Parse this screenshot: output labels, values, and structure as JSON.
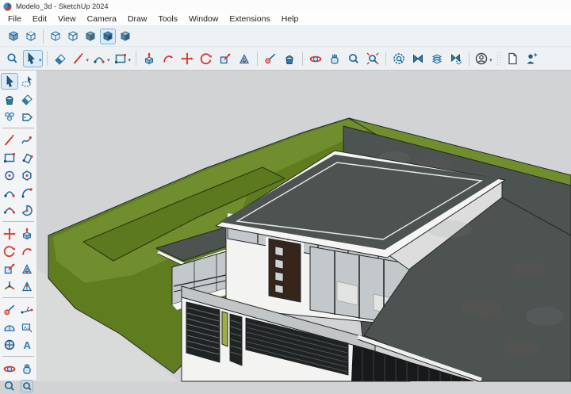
{
  "window": {
    "title": "Modelo_3d - SketchUp 2024"
  },
  "menu": {
    "items": [
      "File",
      "Edit",
      "View",
      "Camera",
      "Draw",
      "Tools",
      "Window",
      "Extensions",
      "Help"
    ]
  },
  "toolbars": {
    "views": {
      "items": [
        {
          "name": "xray",
          "label": "X-Ray"
        },
        {
          "name": "back-edges",
          "label": "Back Edges"
        },
        {
          "type": "sep"
        },
        {
          "name": "wireframe",
          "label": "Wireframe"
        },
        {
          "name": "hidden-line",
          "label": "Hidden Line"
        },
        {
          "name": "shaded",
          "label": "Shaded"
        },
        {
          "name": "shaded-textures",
          "label": "Shaded With Textures",
          "selected": true
        },
        {
          "name": "monochrome",
          "label": "Monochrome"
        }
      ]
    },
    "main": {
      "items": [
        {
          "name": "search",
          "label": "Search"
        },
        {
          "name": "select",
          "label": "Select",
          "selected": true,
          "dropdown": true
        },
        {
          "type": "sep"
        },
        {
          "name": "eraser",
          "label": "Eraser"
        },
        {
          "name": "line",
          "label": "Line",
          "dropdown": true
        },
        {
          "name": "two-point-arc",
          "label": "Arcs",
          "dropdown": true
        },
        {
          "name": "rectangle",
          "label": "Shapes",
          "dropdown": true
        },
        {
          "type": "sep"
        },
        {
          "name": "push-pull",
          "label": "Push/Pull"
        },
        {
          "name": "follow-me",
          "label": "Follow Me"
        },
        {
          "name": "move",
          "label": "Move"
        },
        {
          "name": "rotate",
          "label": "Rotate"
        },
        {
          "name": "scale",
          "label": "Scale"
        },
        {
          "name": "offset",
          "label": "Offset"
        },
        {
          "type": "sep"
        },
        {
          "name": "tape-measure",
          "label": "Tape Measure"
        },
        {
          "name": "paint-bucket",
          "label": "Paint Bucket"
        },
        {
          "type": "sep"
        },
        {
          "name": "orbit",
          "label": "Orbit"
        },
        {
          "name": "pan",
          "label": "Pan"
        },
        {
          "name": "zoom",
          "label": "Zoom"
        },
        {
          "name": "zoom-extents",
          "label": "Zoom Extents"
        },
        {
          "type": "sep"
        },
        {
          "name": "solid-inspector",
          "label": "Solid Inspector"
        },
        {
          "name": "clean-up",
          "label": "CleanUp"
        },
        {
          "name": "warehouse-layers",
          "label": "3D Warehouse"
        },
        {
          "name": "fix-problems",
          "label": "Fix Problems"
        },
        {
          "type": "sep"
        },
        {
          "name": "account",
          "label": "Account",
          "dropdown": true
        },
        {
          "type": "grip"
        },
        {
          "name": "new-document",
          "label": "New Model"
        },
        {
          "name": "add-collaborator",
          "label": "Add Collaborator"
        }
      ]
    }
  },
  "left_toolbar": {
    "items": [
      {
        "name": "select",
        "label": "Select",
        "selected": true
      },
      {
        "name": "lasso",
        "label": "Lasso"
      },
      {
        "name": "paint-bucket",
        "label": "Paint Bucket"
      },
      {
        "name": "eraser",
        "label": "Eraser"
      },
      {
        "name": "components",
        "label": "Components"
      },
      {
        "name": "tag",
        "label": "Tag"
      },
      {
        "type": "sep"
      },
      {
        "name": "line",
        "label": "Line"
      },
      {
        "name": "freehand",
        "label": "Freehand"
      },
      {
        "name": "rectangle",
        "label": "Rectangle"
      },
      {
        "name": "rotated-rectangle",
        "label": "Rotated Rectangle"
      },
      {
        "name": "circle",
        "label": "Circle"
      },
      {
        "name": "polygon",
        "label": "Polygon"
      },
      {
        "name": "two-point-arc",
        "label": "2 Point Arc"
      },
      {
        "name": "arc",
        "label": "Arc"
      },
      {
        "name": "three-point-arc",
        "label": "3 Point Arc"
      },
      {
        "name": "pie",
        "label": "Pie"
      },
      {
        "type": "sep"
      },
      {
        "name": "move",
        "label": "Move"
      },
      {
        "name": "push-pull",
        "label": "Push/Pull"
      },
      {
        "name": "rotate",
        "label": "Rotate"
      },
      {
        "name": "follow-me",
        "label": "Follow Me"
      },
      {
        "name": "scale",
        "label": "Scale"
      },
      {
        "name": "offset",
        "label": "Offset"
      },
      {
        "name": "axes",
        "label": "Axes"
      },
      {
        "name": "dimensions",
        "label": "Dimensions"
      },
      {
        "type": "sep"
      },
      {
        "name": "tape-measure",
        "label": "Tape Measure"
      },
      {
        "name": "dimension-linear",
        "label": "Linear Dimension"
      },
      {
        "name": "protractor",
        "label": "Protractor"
      },
      {
        "name": "text",
        "label": "Text"
      },
      {
        "name": "position-camera",
        "label": "Position Camera"
      },
      {
        "name": "three-d-text",
        "label": "3D Text"
      },
      {
        "type": "sep"
      },
      {
        "name": "orbit",
        "label": "Orbit"
      },
      {
        "name": "pan",
        "label": "Pan"
      },
      {
        "name": "zoom",
        "label": "Zoom"
      },
      {
        "name": "zoom-window",
        "label": "Zoom Window"
      }
    ]
  },
  "viewport": {
    "description": "3D model of a modern two-storey house with flat roofs, clerestory windows, green terraced lawn, white perimeter wall and dark louvered gates",
    "colors": {
      "bg": "#d2d3d4",
      "street": "#d9dada",
      "grass-side": "#5f7d1f",
      "grass-top": "#708e2d",
      "grass-inset": "#5c7920",
      "roof": "#4d5351",
      "fascia": "#f5f5f4",
      "wall": "#f3f3f2",
      "wall-shade": "#dcdddc",
      "glass": "#c3c8ca",
      "door": "#35251a",
      "gate": "#202324",
      "hedge": "#9db041",
      "beam": "#c2c5c5"
    }
  }
}
